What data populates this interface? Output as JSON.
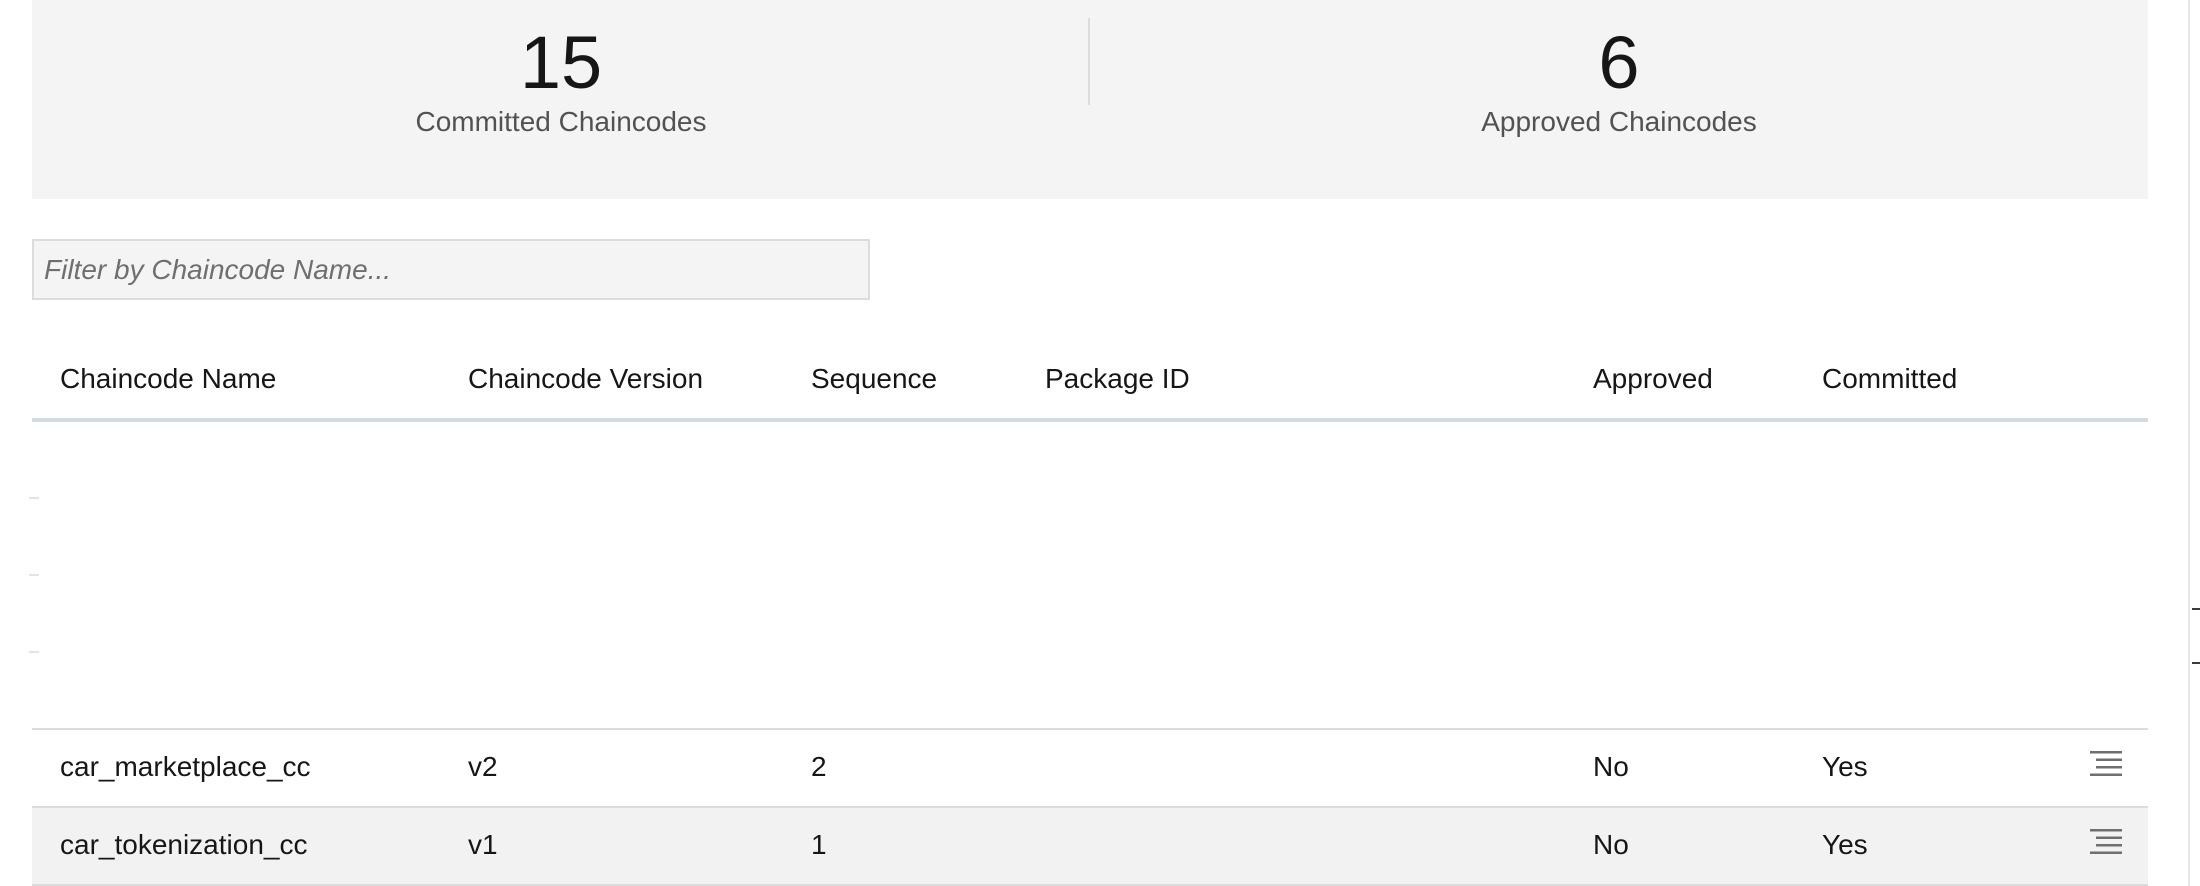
{
  "summary": {
    "committed": {
      "value": "15",
      "label": "Committed Chaincodes"
    },
    "approved": {
      "value": "6",
      "label": "Approved Chaincodes"
    }
  },
  "filter": {
    "placeholder": "Filter by Chaincode Name...",
    "value": ""
  },
  "table": {
    "columns": [
      "Chaincode Name",
      "Chaincode Version",
      "Sequence",
      "Package ID",
      "Approved",
      "Committed"
    ],
    "rows": [
      {
        "name": "car_marketplace_cc",
        "version": "v2",
        "sequence": "2",
        "package_id": "",
        "approved": "No",
        "committed": "Yes",
        "menu_icon": "overflow-menu-icon"
      },
      {
        "name": "car_tokenization_cc",
        "version": "v1",
        "sequence": "1",
        "package_id": "",
        "approved": "No",
        "committed": "Yes",
        "menu_icon": "overflow-menu-icon"
      }
    ]
  }
}
